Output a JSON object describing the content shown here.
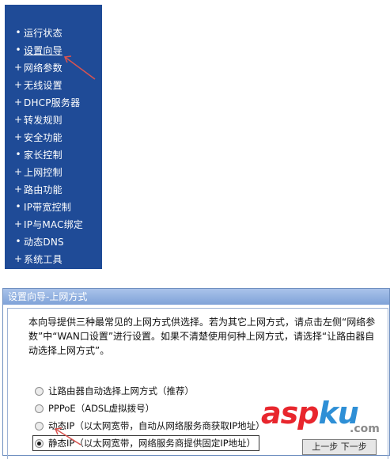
{
  "sidebar": {
    "items": [
      {
        "marker": "•",
        "label": "运行状态"
      },
      {
        "marker": "•",
        "label": "设置向导"
      },
      {
        "marker": "+",
        "label": "网络参数"
      },
      {
        "marker": "+",
        "label": "无线设置"
      },
      {
        "marker": "+",
        "label": "DHCP服务器"
      },
      {
        "marker": "+",
        "label": "转发规则"
      },
      {
        "marker": "+",
        "label": "安全功能"
      },
      {
        "marker": "•",
        "label": "家长控制"
      },
      {
        "marker": "+",
        "label": "上网控制"
      },
      {
        "marker": "+",
        "label": "路由功能"
      },
      {
        "marker": "•",
        "label": "IP带宽控制"
      },
      {
        "marker": "+",
        "label": "IP与MAC绑定"
      },
      {
        "marker": "•",
        "label": "动态DNS"
      },
      {
        "marker": "+",
        "label": "系统工具"
      }
    ],
    "active_index": 1
  },
  "wizard": {
    "title": "设置向导-上网方式",
    "intro": "本向导提供三种最常见的上网方式供选择。若为其它上网方式，请点击左侧“网络参数”中“WAN口设置”进行设置。如果不清楚使用何种上网方式，请选择“让路由器自动选择上网方式”。",
    "options": [
      {
        "label": "让路由器自动选择上网方式（推荐）",
        "checked": false
      },
      {
        "label": "PPPoE（ADSL虚拟拨号）",
        "checked": false
      },
      {
        "label": "动态IP（以太网宽带，自动从网络服务商获取IP地址）",
        "checked": false
      },
      {
        "label": "静态IP（以太网宽带，网络服务商提供固定IP地址）",
        "checked": true
      }
    ],
    "next_label": "上一步    下一步"
  },
  "watermark": {
    "main": "aspku",
    "sub": ".com"
  },
  "colors": {
    "sidebar_bg": "#1f4b97",
    "arrow": "#d9534f",
    "title_bar": "#8caee0"
  }
}
